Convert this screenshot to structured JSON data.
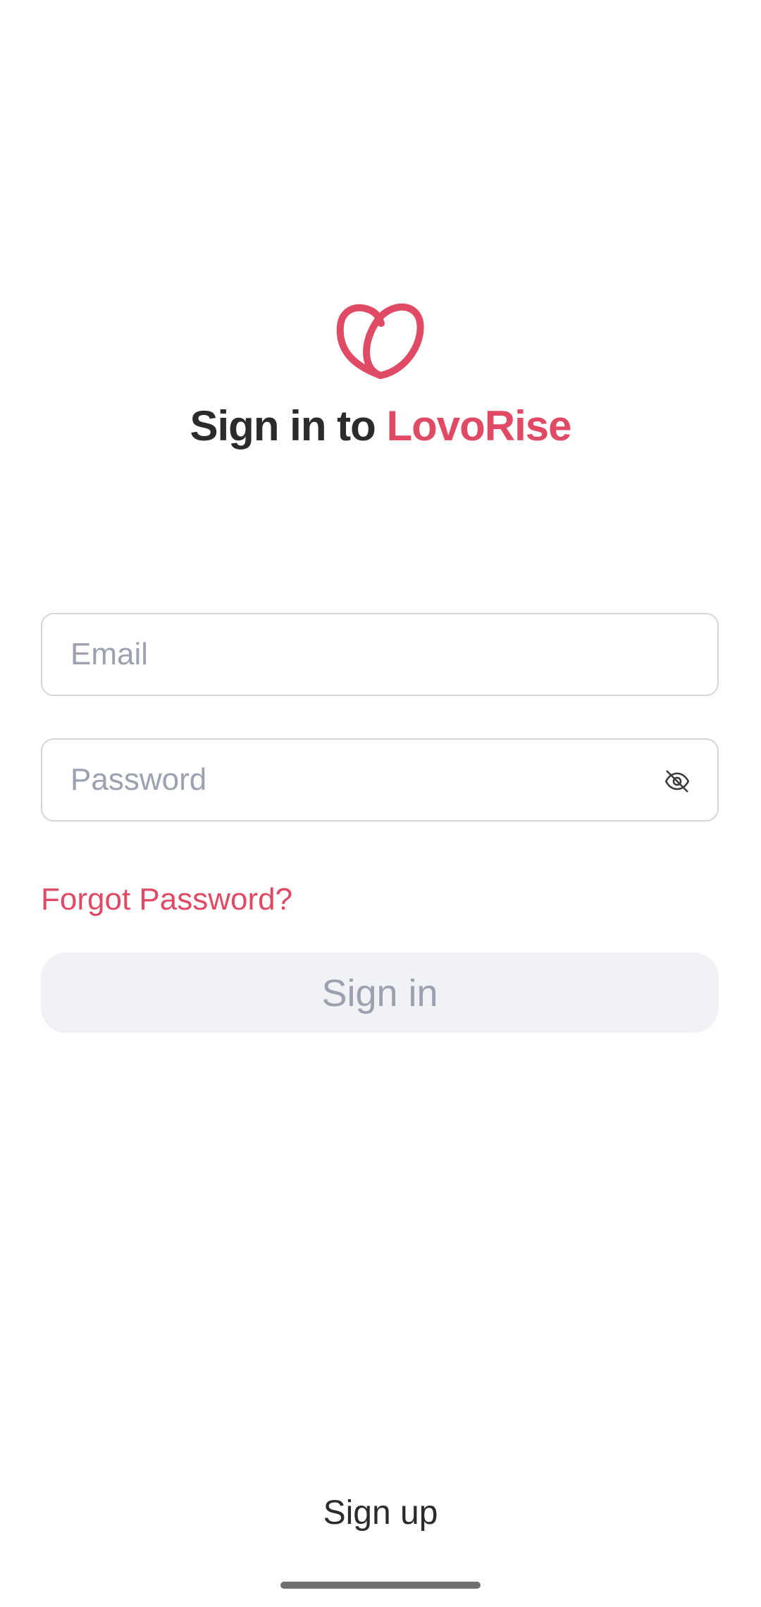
{
  "app": {
    "title_prefix": "Sign in to ",
    "brand_name": "LovoRise",
    "brand_color": "#e04a64",
    "logo_icon": "heart-logo-icon"
  },
  "form": {
    "email_placeholder": "Email",
    "email_value": "",
    "password_placeholder": "Password",
    "password_value": "",
    "password_toggle_icon": "eye-off-icon",
    "forgot_label": "Forgot Password?",
    "signin_label": "Sign in"
  },
  "footer": {
    "signup_label": "Sign up"
  }
}
